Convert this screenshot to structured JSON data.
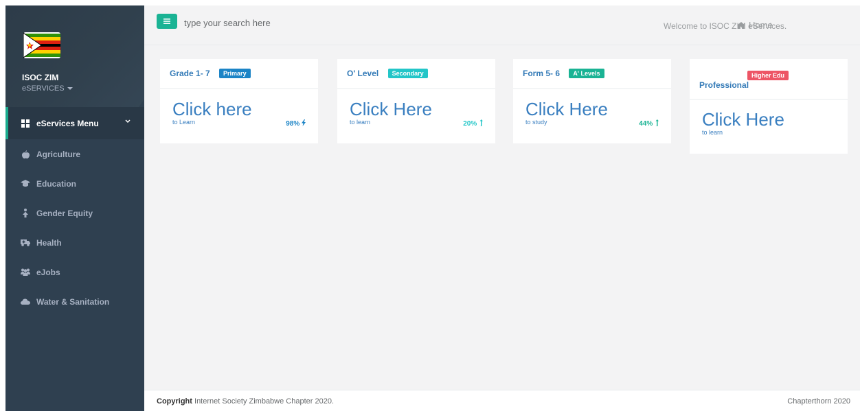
{
  "brand": {
    "name": "ISOC ZIM",
    "subtitle": "eSERVICES"
  },
  "sidebar": {
    "items": [
      {
        "label": "eServices Menu",
        "icon": "th-large-icon"
      },
      {
        "label": "Agriculture",
        "icon": "apple-icon"
      },
      {
        "label": "Education",
        "icon": "graduation-cap-icon"
      },
      {
        "label": "Gender Equity",
        "icon": "female-icon"
      },
      {
        "label": "Health",
        "icon": "ambulance-icon"
      },
      {
        "label": "eJobs",
        "icon": "users-icon"
      },
      {
        "label": "Water & Sanitation",
        "icon": "cloud-icon"
      }
    ]
  },
  "topbar": {
    "search_placeholder": "type your search here",
    "welcome": "Welcome to ISOC ZIM eServices.",
    "home_label": "Home"
  },
  "cards": [
    {
      "title": "Grade 1- 7",
      "badge": "Primary",
      "badge_color": "#1c84c6",
      "link": "Click here",
      "sub": "to Learn",
      "stat": "98%",
      "stat_color": "#1c84c6",
      "stat_icon": "bolt-icon"
    },
    {
      "title": "O' Level",
      "badge": "Secondary",
      "badge_color": "#23c6c8",
      "link": "Click Here",
      "sub": "to learn",
      "stat": "20%",
      "stat_color": "#23c6c8",
      "stat_icon": "level-up-icon"
    },
    {
      "title": "Form 5- 6",
      "badge": "A' Levels",
      "badge_color": "#1ab394",
      "link": "Click Here",
      "sub": "to study",
      "stat": "44%",
      "stat_color": "#1ab394",
      "stat_icon": "level-up-icon"
    },
    {
      "title": "Professional",
      "badge": "Higher Edu",
      "badge_color": "#ed5565",
      "link": "Click Here",
      "sub": "to learn"
    }
  ],
  "footer": {
    "copyright_bold": "Copyright",
    "copyright_text": " Internet Society Zimbabwe Chapter 2020.",
    "right": "Chapterthorn 2020"
  }
}
